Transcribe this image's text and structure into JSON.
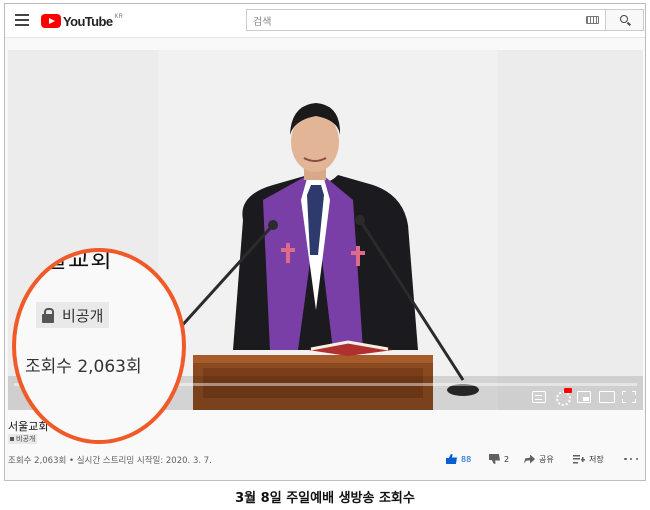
{
  "header": {
    "logo_text": "YouTube",
    "logo_region": "KR",
    "search_placeholder": "검색",
    "keyboard_icon": "keyboard-icon",
    "search_icon": "search-icon",
    "menu_icon": "hamburger-menu-icon"
  },
  "player": {
    "progress_fraction": 0.0,
    "controls": [
      "subtitles-icon",
      "settings-icon",
      "miniplayer-icon",
      "theater-mode-icon",
      "fullscreen-icon"
    ]
  },
  "video": {
    "title": "서울교회",
    "privacy": "비공개",
    "meta": "조회수 2,063회 • 실시간 스트리밍 시작일: 2020. 3. 7."
  },
  "actions": {
    "like_count": "88",
    "dislike_count": "2",
    "share_label": "공유",
    "save_label": "저장"
  },
  "zoom_callout": {
    "title_fragment": "울교회",
    "privacy": "비공개",
    "views": "조회수 2,063회"
  },
  "caption": "3월 8일 주일예배 생방송 조회수",
  "colors": {
    "brand_red": "#ff0000",
    "callout_orange": "#f05a28",
    "like_blue": "#065fd4",
    "stole_purple": "#7a3fa6"
  }
}
